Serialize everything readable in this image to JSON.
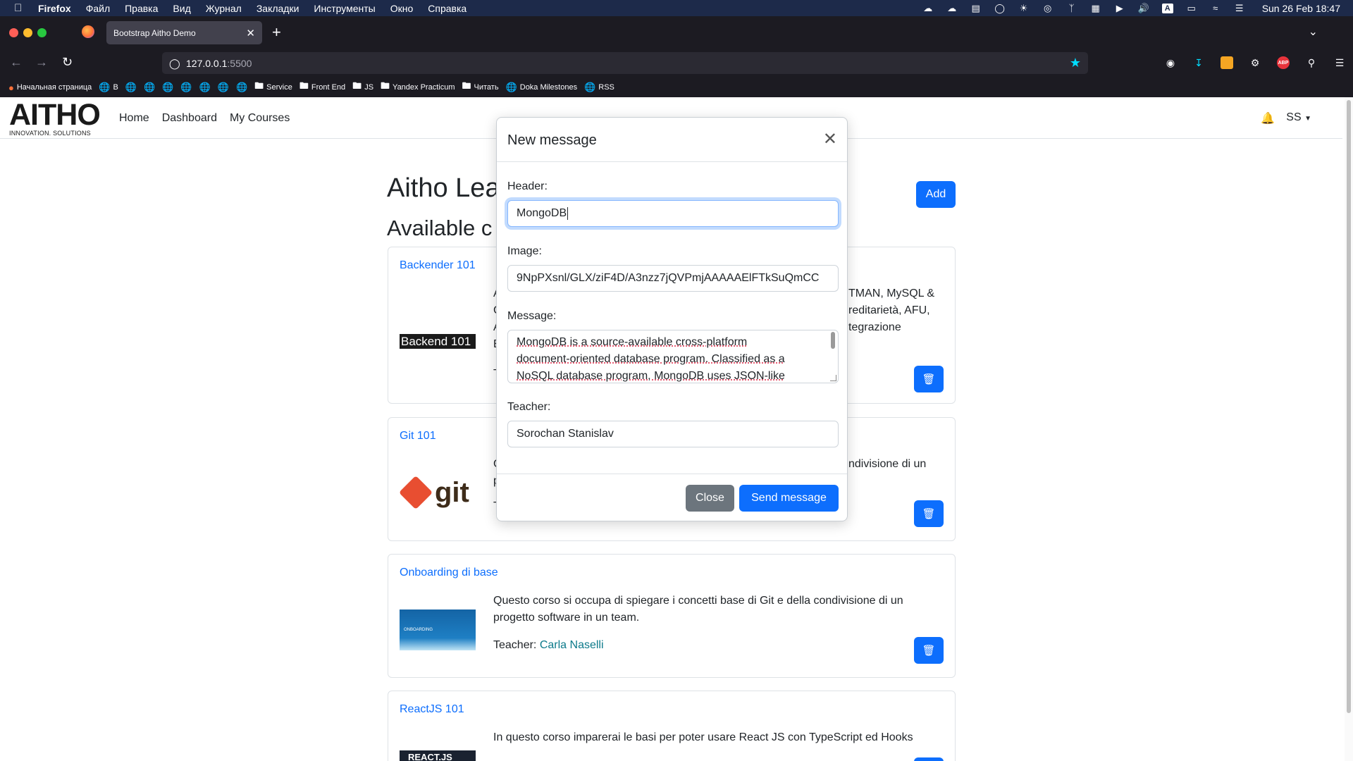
{
  "menubar": {
    "app": "Firefox",
    "items": [
      "Файл",
      "Правка",
      "Вид",
      "Журнал",
      "Закладки",
      "Инструменты",
      "Окно",
      "Справка"
    ],
    "clock": "Sun 26 Feb  18:47",
    "status_icons": [
      "creative-cloud-icon",
      "cloud-icon",
      "clipboard-icon",
      "sync-icon",
      "brightness-icon",
      "shazam-icon",
      "bluetooth-icon",
      "layout-icon",
      "play-icon",
      "volume-icon",
      "keyboard-layout-icon",
      "battery-icon",
      "wifi-icon",
      "control-center-icon"
    ],
    "keyboard_layout": "A"
  },
  "browser": {
    "tab_title": "Bootstrap Aitho Demo",
    "url_host": "127.0.0.1",
    "url_port": ":5500",
    "bookmarks": [
      "Начальная страница",
      "B",
      "",
      "",
      "",
      "",
      "",
      "",
      "",
      "Service",
      "Front End",
      "JS",
      "Yandex Practicum",
      "Читать",
      "Doka Milestones",
      "RSS"
    ],
    "abp_label": "ABP"
  },
  "site": {
    "logo_main": "AITHO",
    "logo_tagline": "INNOVATION. SOLUTIONS",
    "nav": [
      "Home",
      "Dashboard",
      "My Courses"
    ],
    "user_initials": "SS",
    "title": "Aitho Lea",
    "subtitle": "Available c",
    "add_label": "Add"
  },
  "courses": [
    {
      "title": "Backender 101",
      "image_text": "Backend 101",
      "desc_lines": [
        "A",
        "C",
        "A",
        "B"
      ],
      "desc_right": [
        "TMAN, MySQL &",
        "reditarietà, AFU,",
        "tegrazione"
      ],
      "teacher_label": "T"
    },
    {
      "title": "Git 101",
      "image_text": "git",
      "desc_lines": [
        "C",
        "p"
      ],
      "desc_right": [
        "ndivisione di un"
      ],
      "teacher_label": "T"
    },
    {
      "title": "Onboarding di base",
      "image_text": "ONBOARDING",
      "desc": "Questo corso si occupa di spiegare i concetti base di Git e della condivisione di un progetto software in un team.",
      "teacher_label": "Teacher:",
      "teacher": "Carla Naselli"
    },
    {
      "title": "ReactJS 101",
      "image_text": "REACT.JS",
      "desc": "In questo corso imparerai le basi per poter usare React JS con TypeScript ed Hooks"
    }
  ],
  "modal": {
    "title": "New message",
    "header_label": "Header:",
    "header_value": "MongoDB",
    "image_label": "Image:",
    "image_value": "9NpPXsnl/GLX/ziF4D/A3nzz7jQVPmjAAAAAElFTkSuQmCC",
    "message_label": "Message:",
    "message_value": [
      "MongoDB is a source-available cross-platform",
      "document-oriented database program. Classified as a",
      "NoSQL database program, MongoDB uses JSON-like"
    ],
    "teacher_label": "Teacher:",
    "teacher_value": "Sorochan Stanislav",
    "close_label": "Close",
    "send_label": "Send message"
  }
}
